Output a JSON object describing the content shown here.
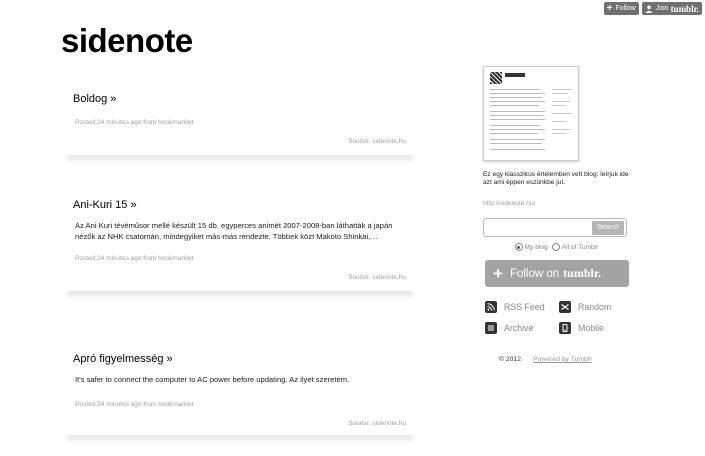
{
  "top_controls": {
    "follow_label": "Follow",
    "join_label": "Join",
    "join_brand": "tumblr."
  },
  "site_title": "sidenote",
  "posts": [
    {
      "title": "Boldog »",
      "body": "",
      "meta": "Posted 24 minutes ago from bookmarklet",
      "source": "Source: sidenote.hu"
    },
    {
      "title": "Ani-Kuri 15 »",
      "body": "Az Ani Kuri tévéműsor mellé készült 15 db. egyperces animét 2007-2008-ban láthatták a japán nézők az NHK csatornán, mindegyiket más-más rendezte. Többek közt Makoto Shinkai,…",
      "meta": "Posted 24 minutes ago from bookmarklet",
      "source": "Source: sidenote.hu"
    },
    {
      "title": "Apró figyelmesség »",
      "body": "It's safer to connect the computer to AC power before updating. Az ilyet szeretem.",
      "meta": "Posted 24 minutes ago from bookmarklet",
      "source": "Source: sidenote.hu"
    }
  ],
  "sidebar": {
    "description": "Ez egy klasszikus értelemben vett blog: leírjuk ide azt ami éppen eszünkbe jut.",
    "url": "http://sidenote.hu/",
    "search": {
      "value": "",
      "placeholder": "",
      "button_label": "Search"
    },
    "radios": [
      {
        "label": "My blog",
        "checked": true
      },
      {
        "label": "All of Tumblr",
        "checked": false
      }
    ],
    "follow_button": {
      "label": "Follow on",
      "brand": "tumblr."
    },
    "links": [
      {
        "label": "RSS Feed",
        "icon": "rss-icon"
      },
      {
        "label": "Random",
        "icon": "shuffle-icon"
      },
      {
        "label": "Archive",
        "icon": "archive-icon"
      },
      {
        "label": "Mobile",
        "icon": "mobile-icon"
      }
    ],
    "footer": {
      "copyright": "© 2012",
      "powered": "Powered by Tumblr"
    }
  },
  "colors": {
    "button_gray": "#707070",
    "follow_gray": "#a3a3a3",
    "meta_gray": "#a0a0a0"
  }
}
